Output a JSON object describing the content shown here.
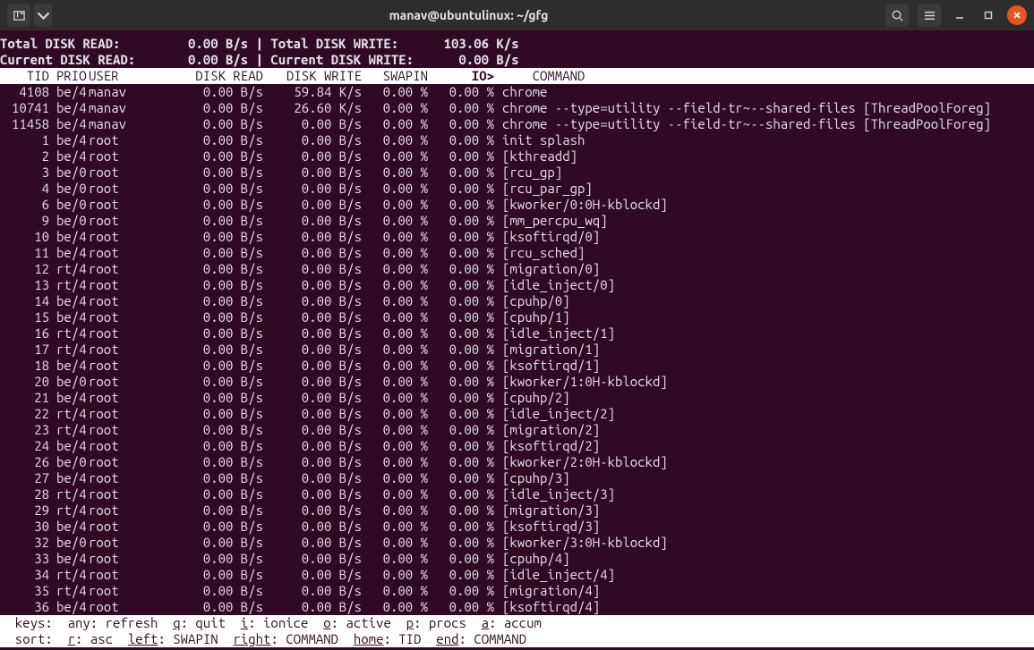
{
  "window": {
    "title": "manav@ubuntulinux: ~/gfg"
  },
  "summary": {
    "total_read_label": "Total DISK READ:",
    "total_read_val": "0.00 B/s",
    "total_write_label": "Total DISK WRITE:",
    "total_write_val": "103.06 K/s",
    "cur_read_label": "Current DISK READ:",
    "cur_read_val": "0.00 B/s",
    "cur_write_label": "Current DISK WRITE:",
    "cur_write_val": "0.00 B/s",
    "sep": "|"
  },
  "columns": {
    "tid": "TID",
    "prio": "PRIO",
    "user": "USER",
    "dr": "DISK READ",
    "dw": "DISK WRITE",
    "sw": "SWAPIN",
    "io": "IO>",
    "cmd": "COMMAND"
  },
  "rows": [
    {
      "tid": "4108",
      "prio": "be/4",
      "user": "manav",
      "dr": "0.00 B/s",
      "dw": "59.84 K/s",
      "sw": "0.00 %",
      "io": "0.00 %",
      "cmd": "chrome"
    },
    {
      "tid": "10741",
      "prio": "be/4",
      "user": "manav",
      "dr": "0.00 B/s",
      "dw": "26.60 K/s",
      "sw": "0.00 %",
      "io": "0.00 %",
      "cmd": "chrome --type=utility --field-tr~--shared-files [ThreadPoolForeg]"
    },
    {
      "tid": "11458",
      "prio": "be/4",
      "user": "manav",
      "dr": "0.00 B/s",
      "dw": "0.00 B/s",
      "sw": "0.00 %",
      "io": "0.00 %",
      "cmd": "chrome --type=utility --field-tr~--shared-files [ThreadPoolForeg]"
    },
    {
      "tid": "1",
      "prio": "be/4",
      "user": "root",
      "dr": "0.00 B/s",
      "dw": "0.00 B/s",
      "sw": "0.00 %",
      "io": "0.00 %",
      "cmd": "init splash"
    },
    {
      "tid": "2",
      "prio": "be/4",
      "user": "root",
      "dr": "0.00 B/s",
      "dw": "0.00 B/s",
      "sw": "0.00 %",
      "io": "0.00 %",
      "cmd": "[kthreadd]"
    },
    {
      "tid": "3",
      "prio": "be/0",
      "user": "root",
      "dr": "0.00 B/s",
      "dw": "0.00 B/s",
      "sw": "0.00 %",
      "io": "0.00 %",
      "cmd": "[rcu_gp]"
    },
    {
      "tid": "4",
      "prio": "be/0",
      "user": "root",
      "dr": "0.00 B/s",
      "dw": "0.00 B/s",
      "sw": "0.00 %",
      "io": "0.00 %",
      "cmd": "[rcu_par_gp]"
    },
    {
      "tid": "6",
      "prio": "be/0",
      "user": "root",
      "dr": "0.00 B/s",
      "dw": "0.00 B/s",
      "sw": "0.00 %",
      "io": "0.00 %",
      "cmd": "[kworker/0:0H-kblockd]"
    },
    {
      "tid": "9",
      "prio": "be/0",
      "user": "root",
      "dr": "0.00 B/s",
      "dw": "0.00 B/s",
      "sw": "0.00 %",
      "io": "0.00 %",
      "cmd": "[mm_percpu_wq]"
    },
    {
      "tid": "10",
      "prio": "be/4",
      "user": "root",
      "dr": "0.00 B/s",
      "dw": "0.00 B/s",
      "sw": "0.00 %",
      "io": "0.00 %",
      "cmd": "[ksoftirqd/0]"
    },
    {
      "tid": "11",
      "prio": "be/4",
      "user": "root",
      "dr": "0.00 B/s",
      "dw": "0.00 B/s",
      "sw": "0.00 %",
      "io": "0.00 %",
      "cmd": "[rcu_sched]"
    },
    {
      "tid": "12",
      "prio": "rt/4",
      "user": "root",
      "dr": "0.00 B/s",
      "dw": "0.00 B/s",
      "sw": "0.00 %",
      "io": "0.00 %",
      "cmd": "[migration/0]"
    },
    {
      "tid": "13",
      "prio": "rt/4",
      "user": "root",
      "dr": "0.00 B/s",
      "dw": "0.00 B/s",
      "sw": "0.00 %",
      "io": "0.00 %",
      "cmd": "[idle_inject/0]"
    },
    {
      "tid": "14",
      "prio": "be/4",
      "user": "root",
      "dr": "0.00 B/s",
      "dw": "0.00 B/s",
      "sw": "0.00 %",
      "io": "0.00 %",
      "cmd": "[cpuhp/0]"
    },
    {
      "tid": "15",
      "prio": "be/4",
      "user": "root",
      "dr": "0.00 B/s",
      "dw": "0.00 B/s",
      "sw": "0.00 %",
      "io": "0.00 %",
      "cmd": "[cpuhp/1]"
    },
    {
      "tid": "16",
      "prio": "rt/4",
      "user": "root",
      "dr": "0.00 B/s",
      "dw": "0.00 B/s",
      "sw": "0.00 %",
      "io": "0.00 %",
      "cmd": "[idle_inject/1]"
    },
    {
      "tid": "17",
      "prio": "rt/4",
      "user": "root",
      "dr": "0.00 B/s",
      "dw": "0.00 B/s",
      "sw": "0.00 %",
      "io": "0.00 %",
      "cmd": "[migration/1]"
    },
    {
      "tid": "18",
      "prio": "be/4",
      "user": "root",
      "dr": "0.00 B/s",
      "dw": "0.00 B/s",
      "sw": "0.00 %",
      "io": "0.00 %",
      "cmd": "[ksoftirqd/1]"
    },
    {
      "tid": "20",
      "prio": "be/0",
      "user": "root",
      "dr": "0.00 B/s",
      "dw": "0.00 B/s",
      "sw": "0.00 %",
      "io": "0.00 %",
      "cmd": "[kworker/1:0H-kblockd]"
    },
    {
      "tid": "21",
      "prio": "be/4",
      "user": "root",
      "dr": "0.00 B/s",
      "dw": "0.00 B/s",
      "sw": "0.00 %",
      "io": "0.00 %",
      "cmd": "[cpuhp/2]"
    },
    {
      "tid": "22",
      "prio": "rt/4",
      "user": "root",
      "dr": "0.00 B/s",
      "dw": "0.00 B/s",
      "sw": "0.00 %",
      "io": "0.00 %",
      "cmd": "[idle_inject/2]"
    },
    {
      "tid": "23",
      "prio": "rt/4",
      "user": "root",
      "dr": "0.00 B/s",
      "dw": "0.00 B/s",
      "sw": "0.00 %",
      "io": "0.00 %",
      "cmd": "[migration/2]"
    },
    {
      "tid": "24",
      "prio": "be/4",
      "user": "root",
      "dr": "0.00 B/s",
      "dw": "0.00 B/s",
      "sw": "0.00 %",
      "io": "0.00 %",
      "cmd": "[ksoftirqd/2]"
    },
    {
      "tid": "26",
      "prio": "be/0",
      "user": "root",
      "dr": "0.00 B/s",
      "dw": "0.00 B/s",
      "sw": "0.00 %",
      "io": "0.00 %",
      "cmd": "[kworker/2:0H-kblockd]"
    },
    {
      "tid": "27",
      "prio": "be/4",
      "user": "root",
      "dr": "0.00 B/s",
      "dw": "0.00 B/s",
      "sw": "0.00 %",
      "io": "0.00 %",
      "cmd": "[cpuhp/3]"
    },
    {
      "tid": "28",
      "prio": "rt/4",
      "user": "root",
      "dr": "0.00 B/s",
      "dw": "0.00 B/s",
      "sw": "0.00 %",
      "io": "0.00 %",
      "cmd": "[idle_inject/3]"
    },
    {
      "tid": "29",
      "prio": "rt/4",
      "user": "root",
      "dr": "0.00 B/s",
      "dw": "0.00 B/s",
      "sw": "0.00 %",
      "io": "0.00 %",
      "cmd": "[migration/3]"
    },
    {
      "tid": "30",
      "prio": "be/4",
      "user": "root",
      "dr": "0.00 B/s",
      "dw": "0.00 B/s",
      "sw": "0.00 %",
      "io": "0.00 %",
      "cmd": "[ksoftirqd/3]"
    },
    {
      "tid": "32",
      "prio": "be/0",
      "user": "root",
      "dr": "0.00 B/s",
      "dw": "0.00 B/s",
      "sw": "0.00 %",
      "io": "0.00 %",
      "cmd": "[kworker/3:0H-kblockd]"
    },
    {
      "tid": "33",
      "prio": "be/4",
      "user": "root",
      "dr": "0.00 B/s",
      "dw": "0.00 B/s",
      "sw": "0.00 %",
      "io": "0.00 %",
      "cmd": "[cpuhp/4]"
    },
    {
      "tid": "34",
      "prio": "rt/4",
      "user": "root",
      "dr": "0.00 B/s",
      "dw": "0.00 B/s",
      "sw": "0.00 %",
      "io": "0.00 %",
      "cmd": "[idle_inject/4]"
    },
    {
      "tid": "35",
      "prio": "rt/4",
      "user": "root",
      "dr": "0.00 B/s",
      "dw": "0.00 B/s",
      "sw": "0.00 %",
      "io": "0.00 %",
      "cmd": "[migration/4]"
    },
    {
      "tid": "36",
      "prio": "be/4",
      "user": "root",
      "dr": "0.00 B/s",
      "dw": "0.00 B/s",
      "sw": "0.00 %",
      "io": "0.00 %",
      "cmd": "[ksoftirqd/4]"
    }
  ],
  "footer": {
    "keys_label": "keys:",
    "any": "any: refresh",
    "q": "q",
    "q_l": ": quit",
    "i": "i",
    "i_l": ": ionice",
    "o": "o",
    "o_l": ": active",
    "p": "p",
    "p_l": ": procs",
    "a": "a",
    "a_l": ": accum",
    "sort_label": "sort:",
    "r": "r",
    "r_l": ": asc",
    "left": "left",
    "left_l": ": SWAPIN",
    "right": "right",
    "right_l": ": COMMAND",
    "home": "home",
    "home_l": ": TID",
    "end": "end",
    "end_l": ": COMMAND"
  }
}
